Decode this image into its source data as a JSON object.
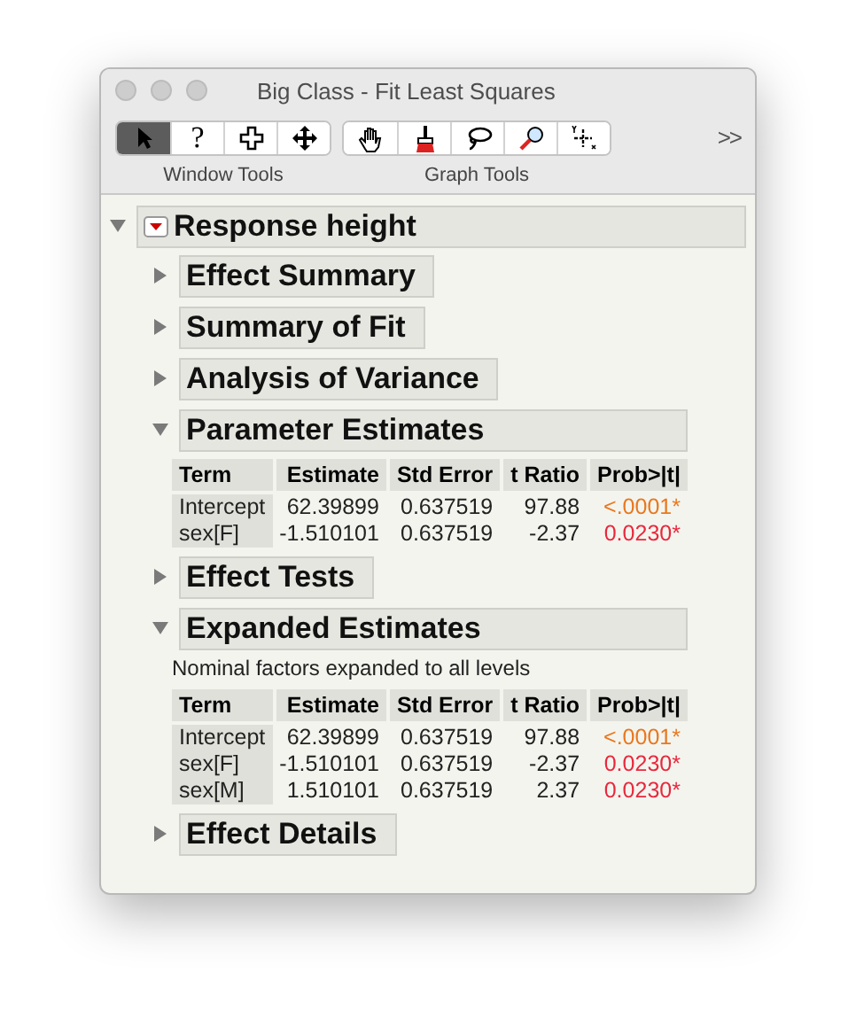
{
  "window": {
    "title": "Big Class - Fit Least Squares"
  },
  "toolbar": {
    "groups": [
      {
        "label": "Window Tools",
        "tools": [
          {
            "kind": "arrow",
            "selected": true
          },
          {
            "kind": "help",
            "glyph": "?",
            "selected": false
          },
          {
            "kind": "crosshair",
            "selected": false
          },
          {
            "kind": "move",
            "selected": false
          }
        ]
      },
      {
        "label": "Graph Tools",
        "tools": [
          {
            "kind": "hand",
            "selected": false
          },
          {
            "kind": "brush",
            "selected": false
          },
          {
            "kind": "lasso",
            "selected": false
          },
          {
            "kind": "magnifier",
            "selected": false
          },
          {
            "kind": "crosshair-xy",
            "selected": false
          }
        ]
      }
    ],
    "overflow": ">>"
  },
  "report": {
    "title": "Response height",
    "expanded": true,
    "sections": [
      {
        "title": "Effect Summary",
        "expanded": false
      },
      {
        "title": "Summary of Fit",
        "expanded": false
      },
      {
        "title": "Analysis of Variance",
        "expanded": false
      },
      {
        "title": "Parameter Estimates",
        "expanded": true,
        "table": {
          "columns": [
            "Term",
            "Estimate",
            "Std Error",
            "t Ratio",
            "Prob>|t|"
          ],
          "rows": [
            {
              "cells": [
                "Intercept",
                "62.39899",
                "0.637519",
                "97.88"
              ],
              "prob": {
                "text": "<.0001*",
                "color": "#e8781e"
              }
            },
            {
              "cells": [
                "sex[F]",
                "-1.510101",
                "0.637519",
                "-2.37"
              ],
              "prob": {
                "text": "0.0230*",
                "color": "#e8283c"
              }
            }
          ]
        }
      },
      {
        "title": "Effect Tests",
        "expanded": false
      },
      {
        "title": "Expanded Estimates",
        "expanded": true,
        "note": "Nominal factors expanded to all levels",
        "table": {
          "columns": [
            "Term",
            "Estimate",
            "Std Error",
            "t Ratio",
            "Prob>|t|"
          ],
          "rows": [
            {
              "cells": [
                "Intercept",
                "62.39899",
                "0.637519",
                "97.88"
              ],
              "prob": {
                "text": "<.0001*",
                "color": "#e8781e"
              }
            },
            {
              "cells": [
                "sex[F]",
                "-1.510101",
                "0.637519",
                "-2.37"
              ],
              "prob": {
                "text": "0.0230*",
                "color": "#e8283c"
              }
            },
            {
              "cells": [
                "sex[M]",
                "1.510101",
                "0.637519",
                "2.37"
              ],
              "prob": {
                "text": "0.0230*",
                "color": "#e8283c"
              }
            }
          ]
        }
      },
      {
        "title": "Effect Details",
        "expanded": false
      }
    ]
  }
}
